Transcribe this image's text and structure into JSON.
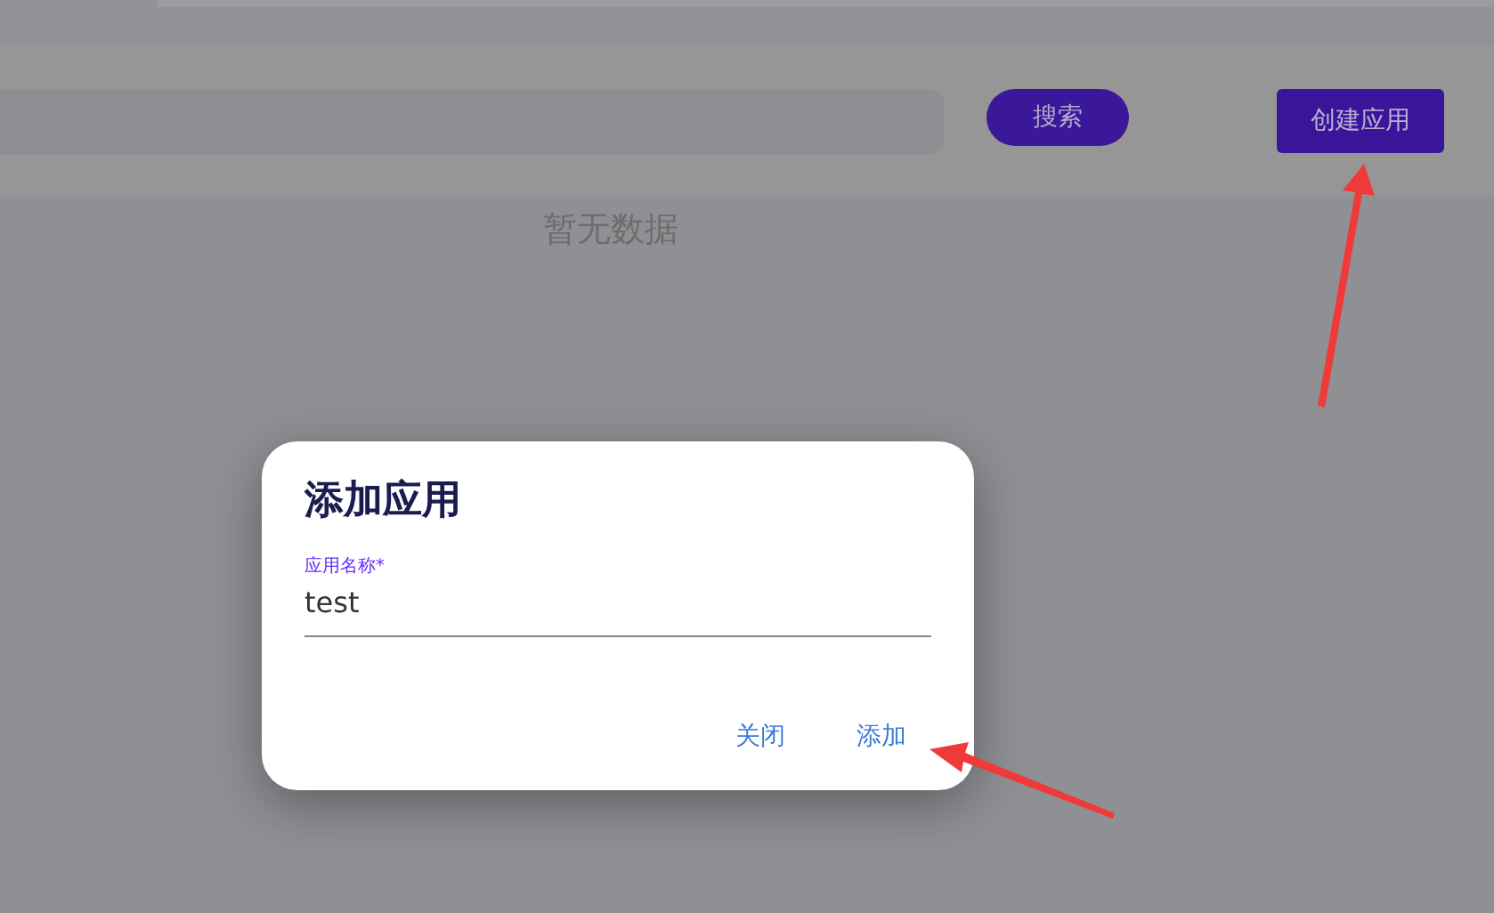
{
  "toolbar": {
    "search_button": "搜索",
    "create_button": "创建应用"
  },
  "empty_text": "暂无数据",
  "dialog": {
    "title": "添加应用",
    "field": {
      "label": "应用名称*",
      "value": "test"
    },
    "buttons": [
      {
        "label": "关闭"
      },
      {
        "label": "添加"
      }
    ]
  }
}
